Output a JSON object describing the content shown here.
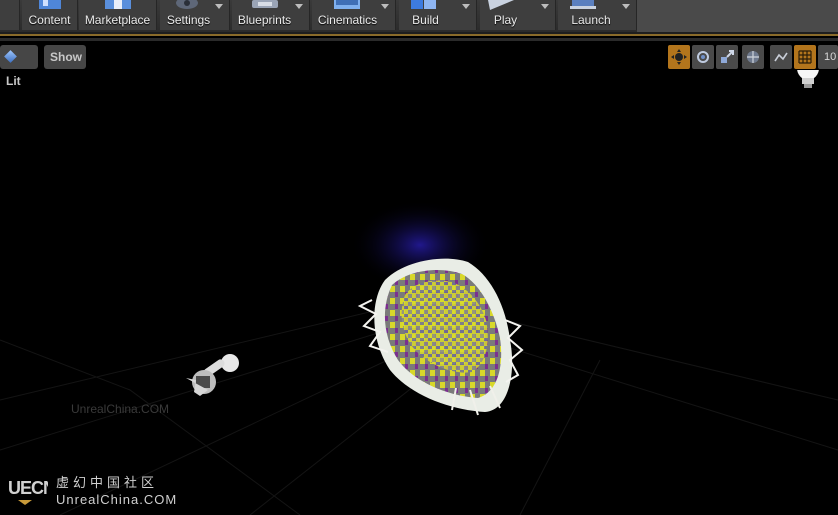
{
  "toolbar": {
    "items": [
      {
        "label": "Content",
        "dropdown": false
      },
      {
        "label": "Marketplace",
        "dropdown": false
      },
      {
        "label": "Settings",
        "dropdown": true
      },
      {
        "label": "Blueprints",
        "dropdown": true
      },
      {
        "label": "Cinematics",
        "dropdown": true
      },
      {
        "label": "Build",
        "dropdown": true
      },
      {
        "label": "Play",
        "dropdown": true
      },
      {
        "label": "Launch",
        "dropdown": true
      }
    ]
  },
  "viewport": {
    "lit_label": "Lit",
    "show_label": "Show",
    "tools": [
      "translate-icon",
      "rotate-icon",
      "scale-icon",
      "world-icon",
      "surface-snap-icon",
      "grid-snap-icon"
    ],
    "partial_number": "10",
    "accent_color": "#b3751c"
  },
  "scene": {
    "small_watermark": "UnrealChina.COM",
    "watermark_logo": "UECN",
    "watermark_cn": "虚幻中国社区",
    "watermark_en": "UnrealChina.COM"
  }
}
